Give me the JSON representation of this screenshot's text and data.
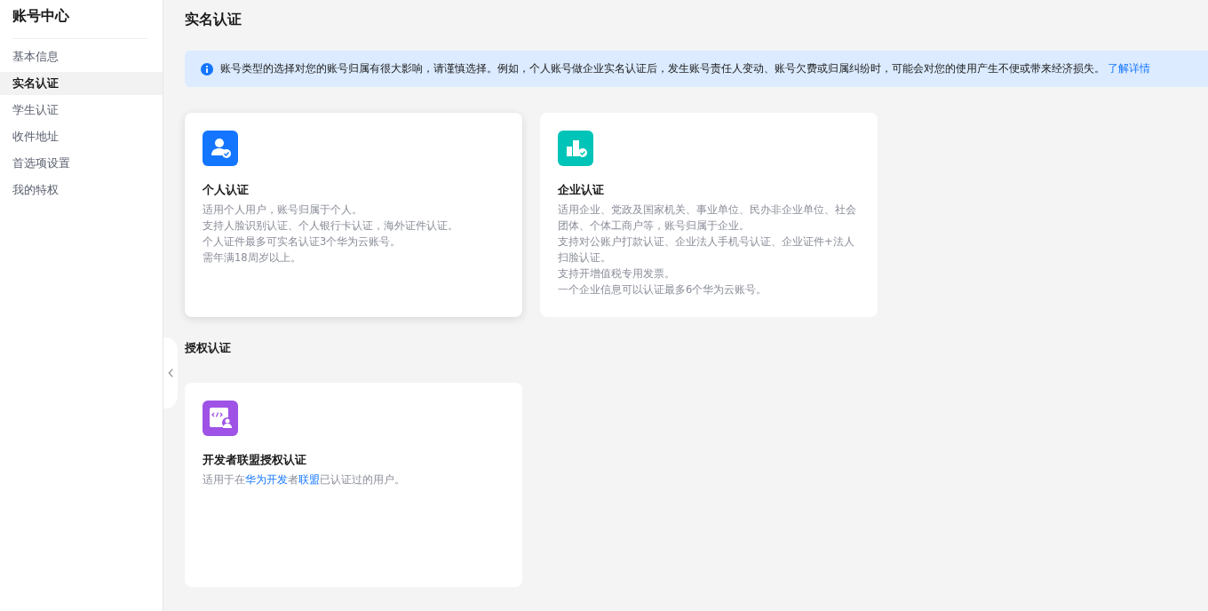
{
  "sidebar": {
    "title": "账号中心",
    "items": [
      {
        "label": "基本信息",
        "selected": false
      },
      {
        "label": "实名认证",
        "selected": true
      },
      {
        "label": "学生认证",
        "selected": false
      },
      {
        "label": "收件地址",
        "selected": false
      },
      {
        "label": "首选项设置",
        "selected": false
      },
      {
        "label": "我的特权",
        "selected": false
      }
    ]
  },
  "page_title": "实名认证",
  "notice": {
    "text": "账号类型的选择对您的账号归属有很大影响，请谨慎选择。例如，个人账号做企业实名认证后，发生账号责任人变动、账号欠费或归属纠纷时，可能会对您的使用产生不便或带来经济损失。",
    "link": "了解详情"
  },
  "sections": [
    {
      "cards": [
        {
          "kind": "person",
          "color": "#1476ff",
          "title": "个人认证",
          "hovered": true,
          "lines": [
            [
              {
                "kind": "text",
                "text": "适用个人用户，账号归属于个人。"
              }
            ],
            [
              {
                "kind": "text",
                "text": "支持人脸识别认证、个人银行卡认证，海外证件认证。"
              }
            ],
            [
              {
                "kind": "text",
                "text": "个人证件最多可实名认证3个华为云账号。"
              }
            ],
            [
              {
                "kind": "text",
                "text": "需年满18周岁以上。"
              }
            ]
          ]
        },
        {
          "kind": "building",
          "color": "#00c4b8",
          "title": "企业认证",
          "hovered": false,
          "lines": [
            [
              {
                "kind": "text",
                "text": "适用企业、党政及国家机关、事业单位、民办非企业单位、社会团体、个体工商户等，账号归属于企业。"
              }
            ],
            [
              {
                "kind": "text",
                "text": "支持对公账户打款认证、企业法人手机号认证、企业证件+法人扫脸认证。"
              }
            ],
            [
              {
                "kind": "text",
                "text": "支持开增值税专用发票。"
              }
            ],
            [
              {
                "kind": "text",
                "text": "一个企业信息可以认证最多6个华为云账号。"
              }
            ]
          ]
        }
      ]
    },
    {
      "title": "授权认证",
      "cards": [
        {
          "kind": "developer",
          "color": "#9e52e6",
          "title": "开发者联盟授权认证",
          "hovered": false,
          "lines": [
            [
              {
                "kind": "text",
                "text": "适用于在"
              },
              {
                "kind": "link",
                "text": "华为开发"
              },
              {
                "kind": "text",
                "text": "者"
              },
              {
                "kind": "link",
                "text": "联盟"
              },
              {
                "kind": "text",
                "text": "已认证过的用户。"
              }
            ]
          ]
        }
      ]
    }
  ]
}
